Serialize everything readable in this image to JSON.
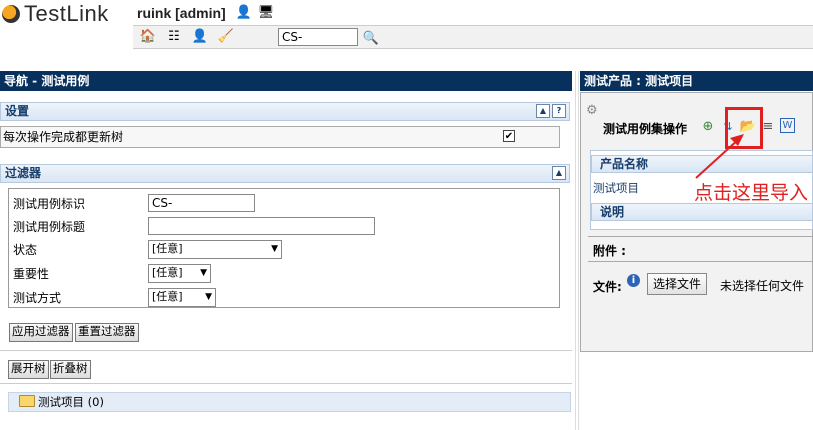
{
  "app": {
    "logo_text": "TestLink",
    "user": "ruink [admin]"
  },
  "header": {
    "search_value": "CS-"
  },
  "left_panel": {
    "title": "导航 - 测试用例",
    "settings": {
      "title": "设置",
      "update_tree_label": "每次操作完成都更新树",
      "update_tree_checked": true
    },
    "filters": {
      "title": "过滤器",
      "fields": [
        {
          "label": "测试用例标识",
          "value": "CS-"
        },
        {
          "label": "测试用例标题",
          "value": ""
        },
        {
          "label": "状态",
          "value": "[任意]"
        },
        {
          "label": "重要性",
          "value": "[任意]"
        },
        {
          "label": "测试方式",
          "value": "[任意]"
        }
      ],
      "apply_label": "应用过滤器",
      "reset_label": "重置过滤器"
    },
    "expand_label": "展开树",
    "collapse_label": "折叠树",
    "tree": {
      "root_label": "测试项目 (0)"
    }
  },
  "right_panel": {
    "title": "测试产品 : 测试项目",
    "ops_title": "测试用例集操作",
    "product_name_header": "产品名称",
    "product_name_value": "测试项目",
    "description_header": "说明",
    "attachments_label": "附件 :",
    "file_label": "文件:",
    "choose_file_label": "选择文件",
    "no_file_label": "未选择任何文件"
  },
  "annotation": {
    "text": "点击这里导入",
    "color": "#e02020"
  },
  "colors": {
    "panel_title_bg": "#08305c",
    "section_text": "#173d6c"
  }
}
